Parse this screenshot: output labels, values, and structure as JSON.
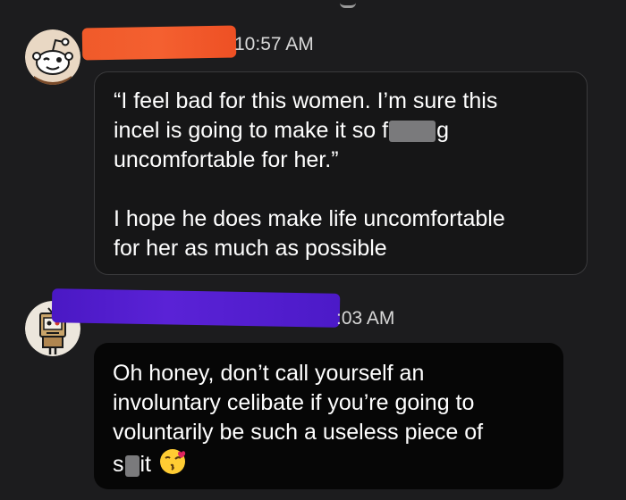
{
  "conversation": {
    "messages": [
      {
        "timestamp": "10:57 AM",
        "paragraphs": [
          {
            "lines": [
              [
                {
                  "t": "“I feel bad for this women. I’m sure this"
                }
              ],
              [
                {
                  "t": "incel is going to make it so f"
                },
                {
                  "censor": true,
                  "w": 52
                },
                {
                  "t": "g"
                }
              ],
              [
                {
                  "t": "uncomfortable for her.”"
                }
              ]
            ]
          },
          {
            "lines": [
              [
                {
                  "t": "I hope he does make life uncomfortable"
                }
              ],
              [
                {
                  "t": "for her as much as possible"
                }
              ]
            ]
          }
        ]
      },
      {
        "timestamp": ":03 AM",
        "paragraphs": [
          {
            "lines": [
              [
                {
                  "t": "Oh honey, don’t call yourself an"
                }
              ],
              [
                {
                  "t": "involuntary celibate if you’re going to"
                }
              ],
              [
                {
                  "t": "voluntarily be such a useless piece of"
                }
              ],
              [
                {
                  "t": "s"
                },
                {
                  "censor": true,
                  "w": 16
                },
                {
                  "t": "it"
                },
                {
                  "emoji": "kissing-heart-emoji"
                }
              ]
            ]
          }
        ]
      }
    ]
  },
  "colors": {
    "background": "#1c1c1e",
    "bubble_border": "#3a3a3c",
    "redaction_orange": "#f05a2a",
    "redaction_purple": "#4a18c4"
  },
  "icons": {
    "avatar_1": "snoo-avatar-icon",
    "avatar_2": "box-robot-avatar-icon"
  }
}
